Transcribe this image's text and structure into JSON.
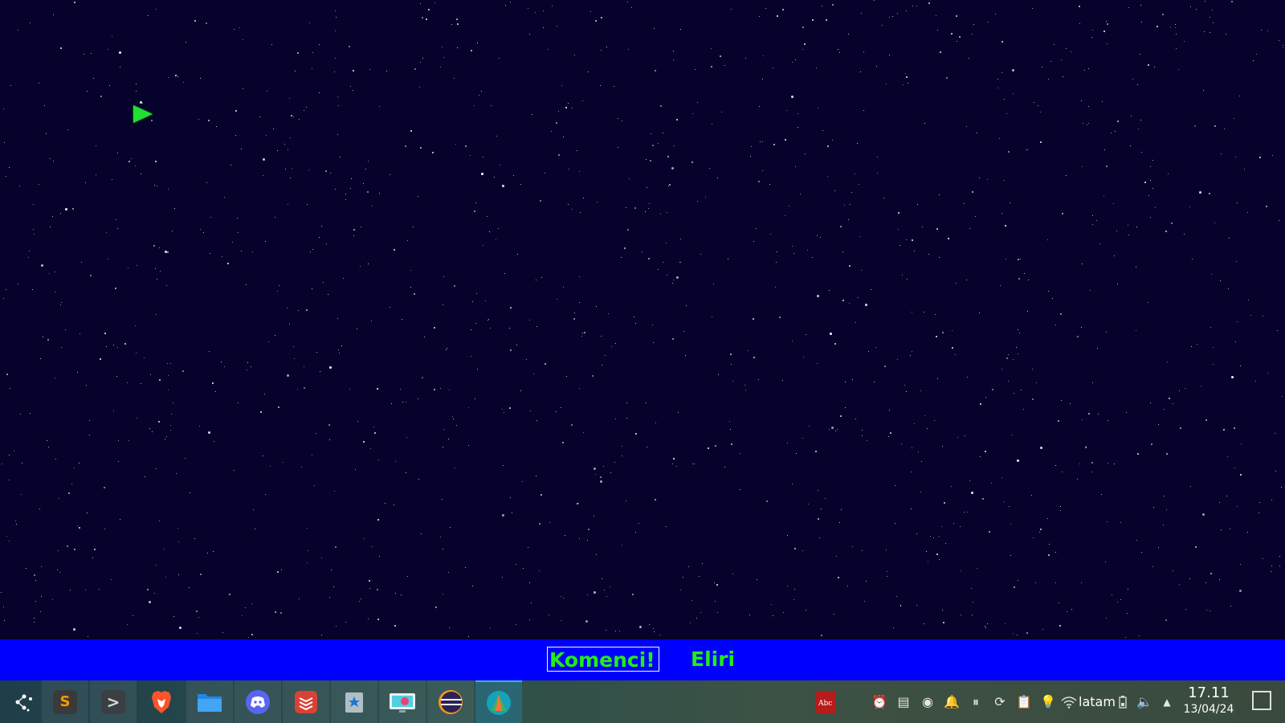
{
  "game": {
    "menu_options": [
      {
        "label": "Komenci!",
        "selected": true
      },
      {
        "label": "Eliri",
        "selected": false
      }
    ],
    "colors": {
      "background": "#07022b",
      "menu_bar": "#0000ff",
      "menu_text": "#22ee11",
      "ship": "#22dd33"
    }
  },
  "taskbar": {
    "launcher_icon": "application-launcher-icon",
    "tasks": [
      {
        "icon": "sublime-text-icon"
      },
      {
        "icon": "terminal-icon"
      },
      {
        "icon": "brave-browser-icon"
      },
      {
        "icon": "file-manager-icon"
      },
      {
        "icon": "discord-icon"
      },
      {
        "icon": "todoist-icon"
      },
      {
        "icon": "image-viewer-icon"
      },
      {
        "icon": "screenshot-tool-icon"
      },
      {
        "icon": "eclipse-icon"
      },
      {
        "icon": "game-app-icon",
        "active": true
      }
    ],
    "tray": {
      "dictionary_icon": "dictionary-icon",
      "icons": [
        "alarm-icon",
        "notes-icon",
        "discord-tray-icon",
        "notifications-icon",
        "media-pause-icon",
        "update-icon",
        "clipboard-icon",
        "lightbulb-icon",
        "wifi-icon"
      ],
      "keyboard_layout": "latam",
      "after_icons": [
        "battery-icon",
        "volume-icon",
        "expand-arrow-icon"
      ]
    },
    "clock": {
      "time": "17.11",
      "date": "13/04/24"
    }
  }
}
